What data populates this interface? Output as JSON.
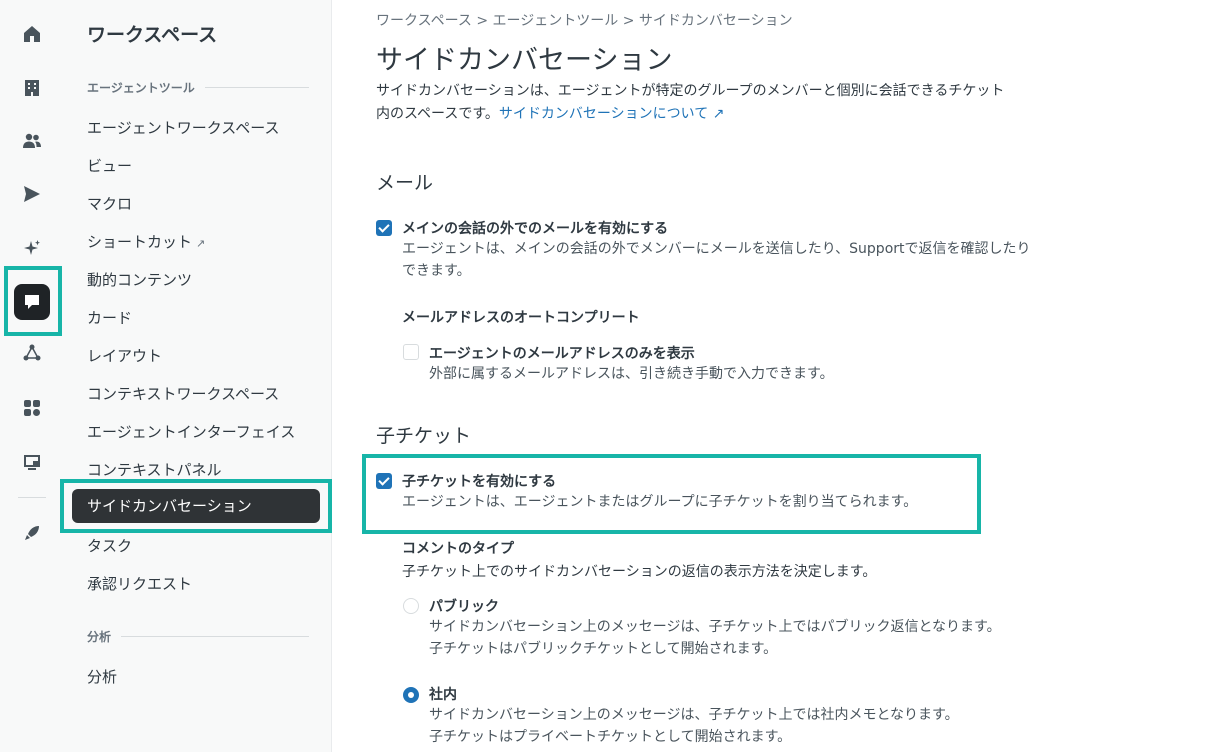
{
  "rail": {
    "icons": [
      "home-icon",
      "building-icon",
      "users-icon",
      "send-icon",
      "sparkle-icon",
      "chat-icon",
      "share-icon",
      "apps-icon",
      "workspace-icon",
      "rocket-icon"
    ]
  },
  "nav": {
    "title": "ワークスペース",
    "section_agent_tools": "エージェントツール",
    "items": [
      "エージェントワークスペース",
      "ビュー",
      "マクロ",
      "ショートカット",
      "動的コンテンツ",
      "カード",
      "レイアウト",
      "コンテキストワークスペース",
      "エージェントインターフェイス",
      "コンテキストパネル",
      "サイドカンバセーション",
      "タスク",
      "承認リクエスト"
    ],
    "section_analytics": "分析",
    "analytics_items": [
      "分析"
    ]
  },
  "main": {
    "breadcrumb": [
      "ワークスペース",
      "エージェントツール",
      "サイドカンバセーション"
    ],
    "breadcrumb_sep": ">",
    "title": "サイドカンバセーション",
    "description": "サイドカンバセーションは、エージェントが特定のグループのメンバーと個別に会話できるチケット内のスペースです。",
    "description_link": "サイドカンバセーションについて",
    "email": {
      "heading": "メール",
      "enable_label": "メインの会話の外でのメールを有効にする",
      "enable_hint": "エージェントは、メインの会話の外でメンバーにメールを送信したり、Supportで返信を確認したりできます。",
      "autocomplete_heading": "メールアドレスのオートコンプリート",
      "agent_only_label": "エージェントのメールアドレスのみを表示",
      "agent_only_hint": "外部に属するメールアドレスは、引き続き手動で入力できます。"
    },
    "child": {
      "heading": "子チケット",
      "enable_label": "子チケットを有効にする",
      "enable_hint": "エージェントは、エージェントまたはグループに子チケットを割り当てられます。",
      "comment_type_heading": "コメントのタイプ",
      "comment_type_hint": "子チケット上でのサイドカンバセーションの返信の表示方法を決定します。",
      "public_label": "パブリック",
      "public_hint_1": "サイドカンバセーション上のメッセージは、子チケット上ではパブリック返信となります。",
      "public_hint_2": "子チケットはパブリックチケットとして開始されます。",
      "internal_label": "社内",
      "internal_hint_1": "サイドカンバセーション上のメッセージは、子チケット上では社内メモとなります。",
      "internal_hint_2": "子チケットはプライベートチケットとして開始されます。"
    }
  },
  "colors": {
    "accent": "#17b5a8",
    "link": "#1f73b7",
    "selected_bg": "#2f3336"
  }
}
